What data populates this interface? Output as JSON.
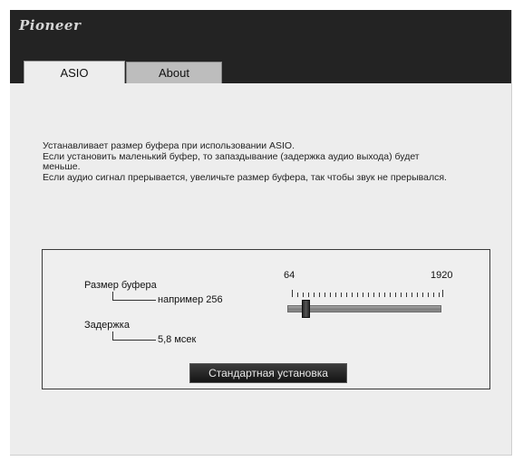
{
  "header": {
    "logo_text": "Pioneer"
  },
  "tabs": [
    {
      "label": "ASIO",
      "active": true
    },
    {
      "label": "About",
      "active": false
    }
  ],
  "description": [
    "Устанавливает размер буфера при использовании ASIO.",
    "Если установить маленький буфер, то запаздывание (задержка аудио выхода) будет",
    "меньше.",
    "Если аудио сигнал прерывается, увеличьте размер буфера, так чтобы звук не прерывался."
  ],
  "buffer": {
    "label": "Размер буфера",
    "example": "например 256",
    "scale_min": "64",
    "scale_max": "1920",
    "slider_fraction": 0.1
  },
  "latency": {
    "label": "Задержка",
    "value": "5,8 мсек"
  },
  "default_button_label": "Стандартная установка",
  "colors": {
    "header_bg": "#232323",
    "window_bg": "#ededed",
    "button_bg": "#1e1e1e"
  }
}
